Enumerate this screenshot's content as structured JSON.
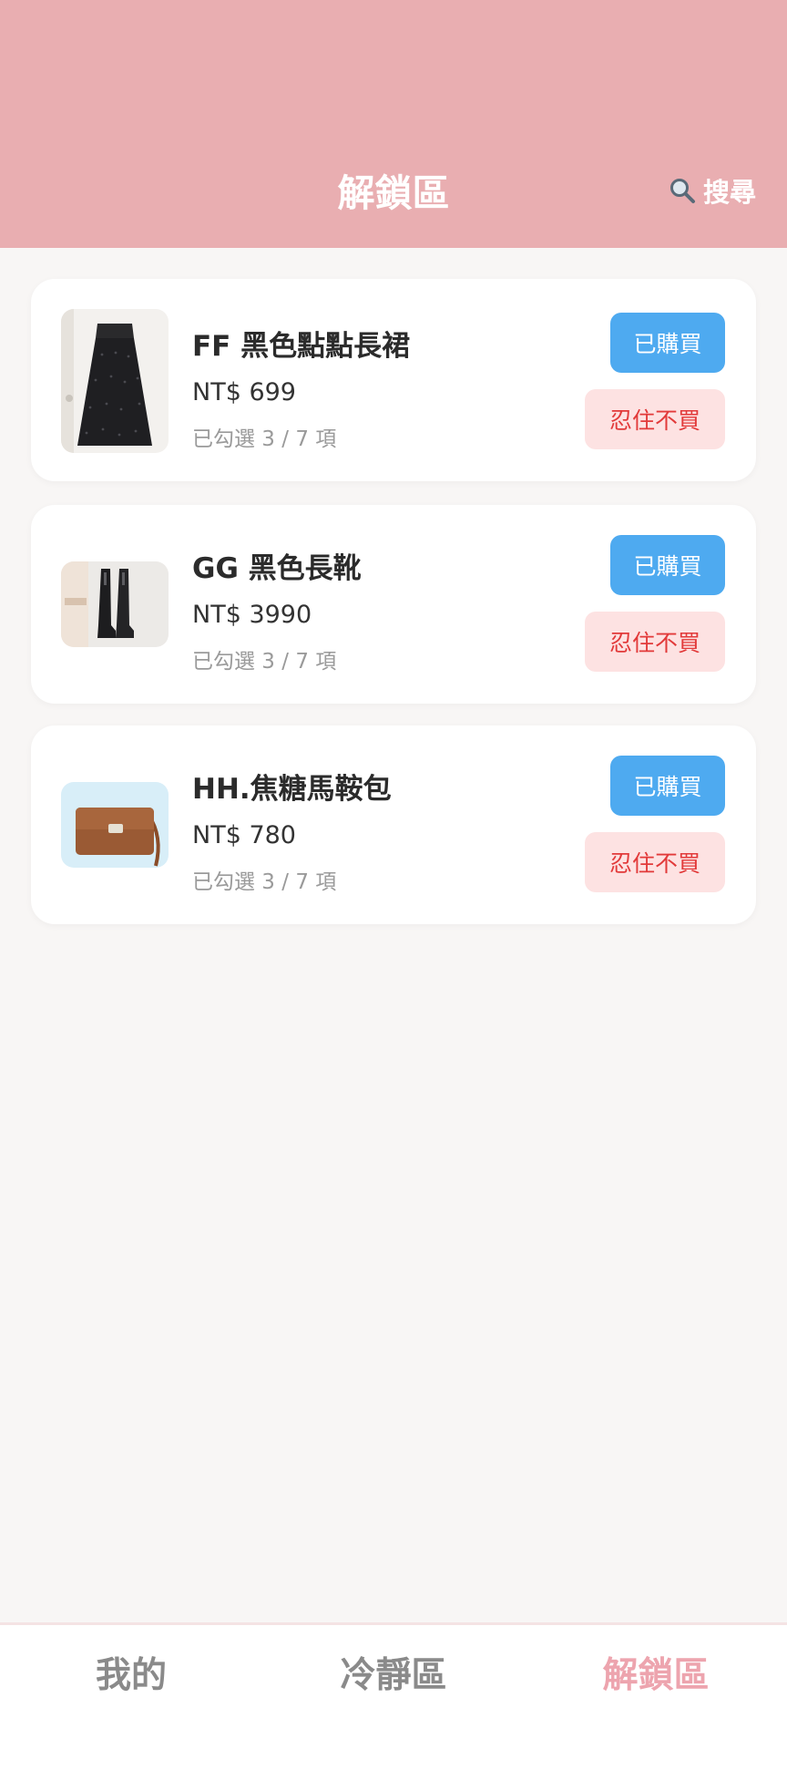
{
  "header": {
    "title": "解鎖區",
    "search_label": "搜尋",
    "search_icon": "search-icon"
  },
  "items": [
    {
      "name": "FF 黑色點點長裙",
      "price": "NT$ 699",
      "progress": "已勾選 3 / 7 項",
      "bought_label": "已購買",
      "resist_label": "忍住不買",
      "image": "black-polka-dot-skirt"
    },
    {
      "name": "GG 黑色長靴",
      "price": "NT$ 3990",
      "progress": "已勾選 3 / 7 項",
      "bought_label": "已購買",
      "resist_label": "忍住不買",
      "image": "black-boots"
    },
    {
      "name": "HH.焦糖馬鞍包",
      "price": "NT$ 780",
      "progress": "已勾選 3 / 7 項",
      "bought_label": "已購買",
      "resist_label": "忍住不買",
      "image": "caramel-saddle-bag"
    }
  ],
  "tabs": [
    {
      "label": "我的",
      "active": false
    },
    {
      "label": "冷靜區",
      "active": false
    },
    {
      "label": "解鎖區",
      "active": true
    }
  ],
  "colors": {
    "header_bg": "#e9aeb1",
    "bought_button": "#4eaaf0",
    "resist_button_bg": "#fde2e2",
    "resist_button_text": "#e23a3a",
    "active_tab": "#eda4ae"
  }
}
